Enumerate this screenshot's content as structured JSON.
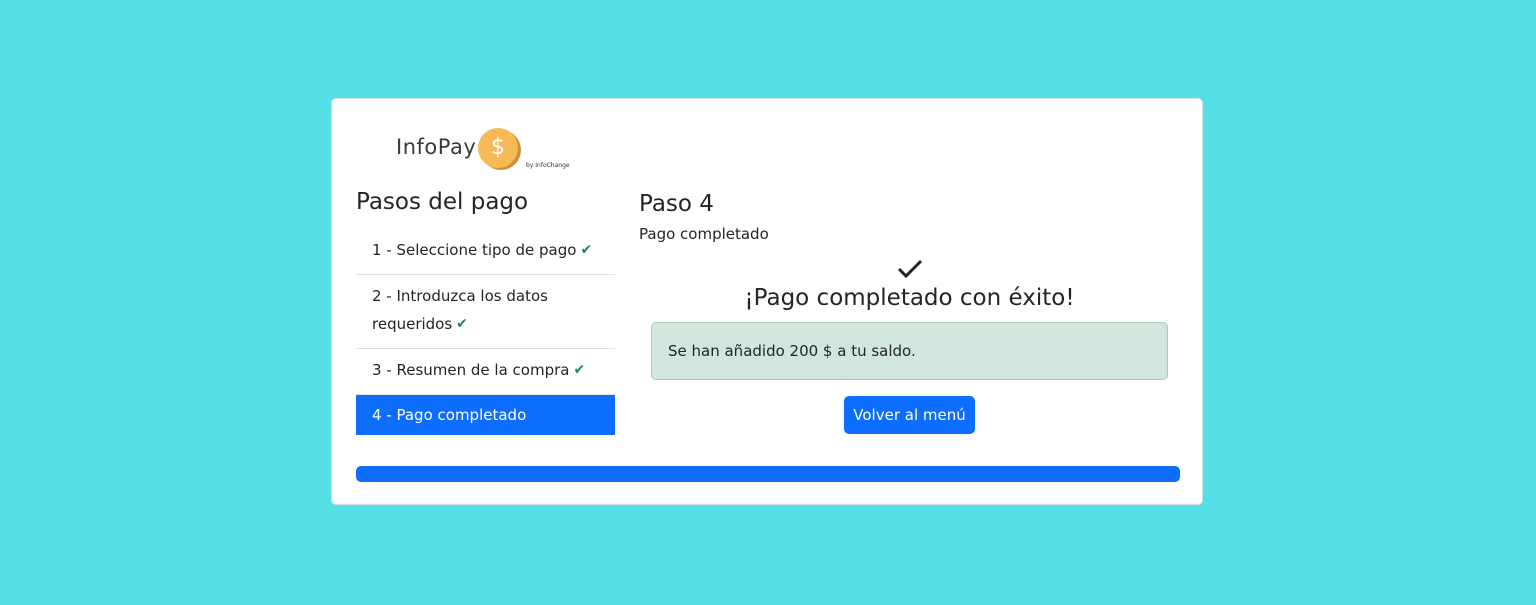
{
  "logo": {
    "text": "InfoPay",
    "coin_symbol": "$",
    "byline": "by InfoChange"
  },
  "sidebar": {
    "title": "Pasos del pago",
    "steps": [
      {
        "label": "1 - Seleccione tipo de pago",
        "done": true
      },
      {
        "label": "2 - Introduzca los datos requeridos",
        "done": true
      },
      {
        "label": "3 - Resumen de la compra",
        "done": true
      },
      {
        "label": "4 - Pago completado",
        "done": false,
        "active": true
      }
    ]
  },
  "main": {
    "title": "Paso 4",
    "subtitle": "Pago completado",
    "success_message": "¡Pago completado con éxito!",
    "alert_text": "Se han añadido 200 $ a tu saldo.",
    "button_label": "Volver al menú"
  },
  "progress": {
    "percent": 100
  },
  "colors": {
    "background": "#55dfe6",
    "primary": "#0d6efd",
    "success": "#198754",
    "alert_bg": "#d1e7dd",
    "coin": "#f7b955"
  },
  "icons": {
    "step_done": "checkmark-icon",
    "success": "checkmark-icon",
    "coin": "dollar-coin-icon"
  }
}
